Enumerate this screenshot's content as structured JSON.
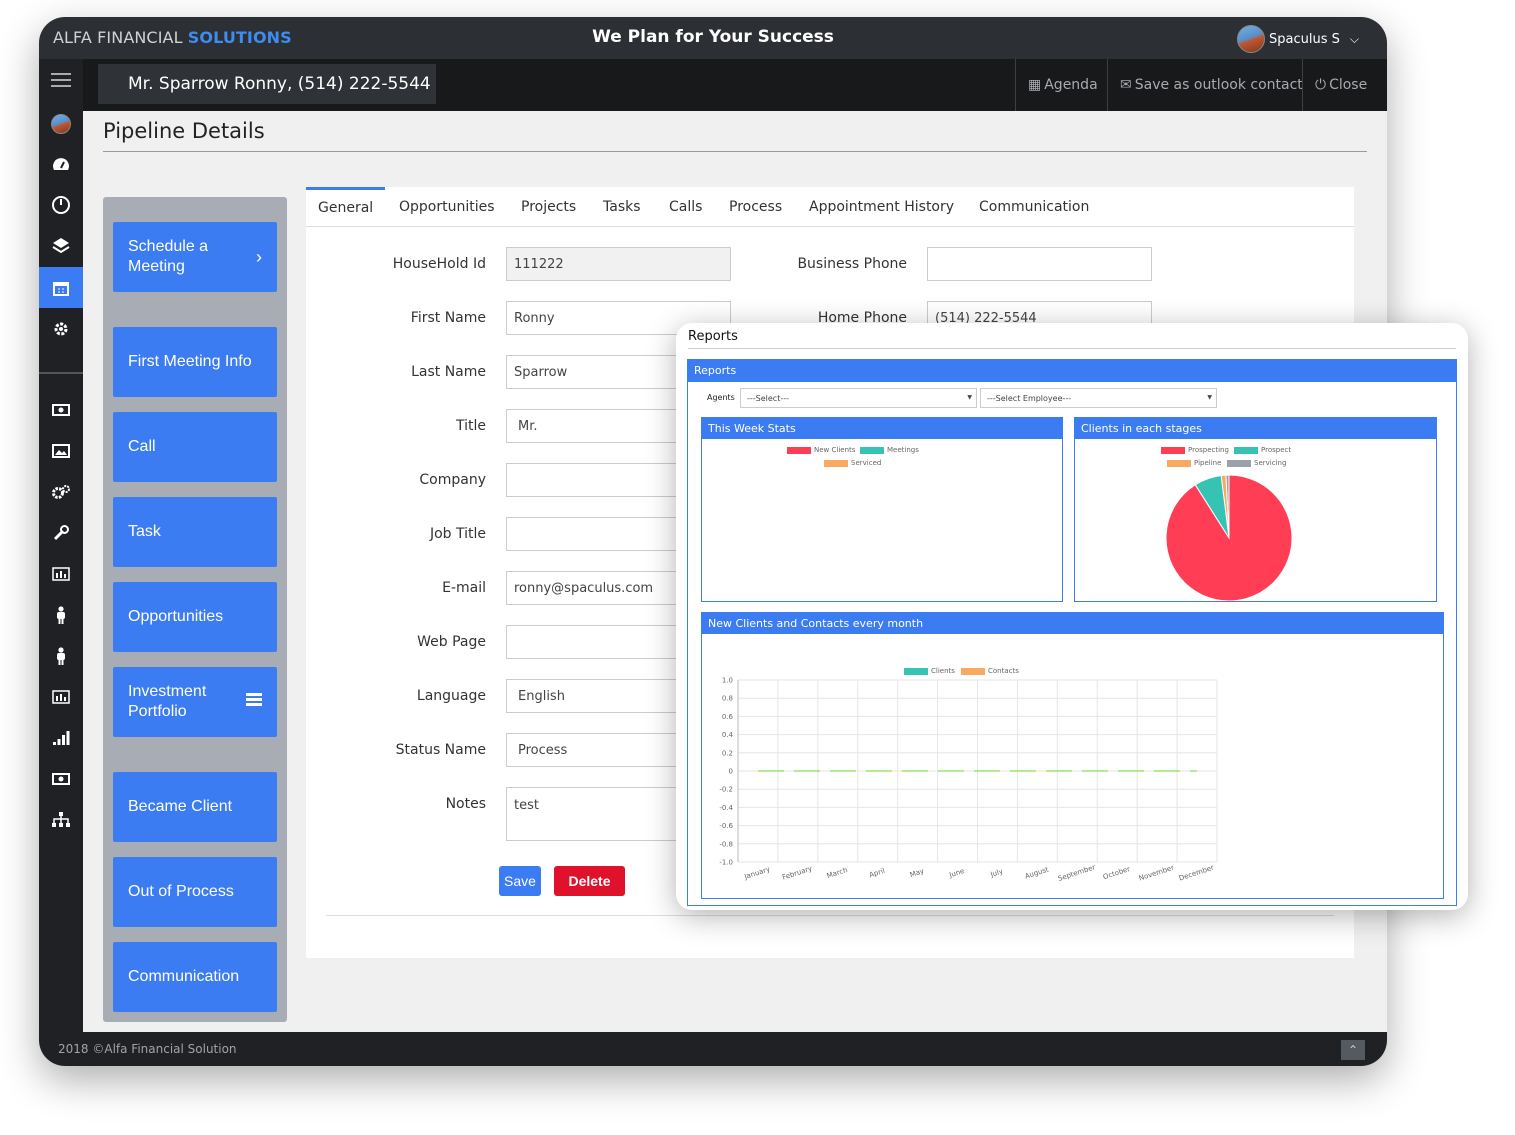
{
  "brand": {
    "part1": "ALFA FINANCIAL ",
    "part2": "SOLUTIONS"
  },
  "tagline": "We Plan for Your Success",
  "user": {
    "name": "Spaculus S",
    "chevron": "⌄"
  },
  "contact": {
    "name": "Mr. Sparrow Ronny, (514) 222-5544"
  },
  "toolbar": {
    "agenda": "Agenda",
    "save_outlook": "Save as outlook contact",
    "close": "Close"
  },
  "sidebar_icons": [
    "menu-icon",
    "avatar",
    "dashboard-icon",
    "dial-icon",
    "layers-icon",
    "calendar-icon",
    "settings-icon",
    "money-icon",
    "image-icon",
    "gears-icon",
    "wrench-icon",
    "bar-chart-icon",
    "person-icon",
    "person-icon",
    "bar-chart-icon",
    "signal-icon",
    "money-icon",
    "sitemap-icon"
  ],
  "page_title": "Pipeline Details",
  "left_buttons": [
    {
      "label": "Schedule a Meeting",
      "icon": "chevron-right-icon"
    },
    {
      "label": "First Meeting Info"
    },
    {
      "label": "Call"
    },
    {
      "label": "Task"
    },
    {
      "label": "Opportunities"
    },
    {
      "label": "Investment Portfolio",
      "icon": "list-icon"
    },
    {
      "label": "Became Client"
    },
    {
      "label": "Out of Process"
    },
    {
      "label": "Communication"
    }
  ],
  "tabs": [
    "General",
    "Opportunities",
    "Projects",
    "Tasks",
    "Calls",
    "Process",
    "Appointment History",
    "Communication"
  ],
  "active_tab": "General",
  "form": {
    "household_id": {
      "label": "HouseHold Id",
      "value": "111222"
    },
    "first_name": {
      "label": "First Name",
      "value": "Ronny"
    },
    "last_name": {
      "label": "Last Name",
      "value": "Sparrow"
    },
    "title": {
      "label": "Title",
      "value": "Mr."
    },
    "company": {
      "label": "Company",
      "value": ""
    },
    "job_title": {
      "label": "Job Title",
      "value": ""
    },
    "email": {
      "label": "E-mail",
      "value": "ronny@spaculus.com"
    },
    "web_page": {
      "label": "Web Page",
      "value": ""
    },
    "language": {
      "label": "Language",
      "value": "English"
    },
    "status_name": {
      "label": "Status Name",
      "value": "Process"
    },
    "notes": {
      "label": "Notes",
      "value": "test"
    },
    "business_phone": {
      "label": "Business Phone",
      "value": ""
    },
    "home_phone": {
      "label": "Home Phone",
      "value": "(514) 222-5544"
    }
  },
  "actions": {
    "save": "Save",
    "delete": "Delete"
  },
  "footer": {
    "copyright": "2018 ©Alfa Financial Solution"
  },
  "reports": {
    "window_title": "Reports",
    "panel_title": "Reports",
    "agents_label": "Agents",
    "agent_select": "---Select---",
    "employee_select": "---Select Employee---"
  },
  "colors": {
    "accent": "#3c7cf2",
    "danger": "#e0112b",
    "topbar": "#2c2f33",
    "sidebar": "#1f2124"
  },
  "chart_data": [
    {
      "type": "bar",
      "title": "This Week Stats",
      "series": [
        {
          "name": "New Clients",
          "color": "#ff3d55",
          "values": []
        },
        {
          "name": "Meetings",
          "color": "#36c3b4",
          "values": []
        },
        {
          "name": "Serviced",
          "color": "#f9a860",
          "values": []
        }
      ]
    },
    {
      "type": "pie",
      "title": "Clients in each stages",
      "slices": [
        {
          "name": "Prospecting",
          "value": 91,
          "color": "#ff3d55"
        },
        {
          "name": "Prospect",
          "value": 7,
          "color": "#36c3b4"
        },
        {
          "name": "Pipeline",
          "value": 1.2,
          "color": "#f9a860"
        },
        {
          "name": "Servicing",
          "value": 0.8,
          "color": "#9aa1a9"
        }
      ]
    },
    {
      "type": "line",
      "title": "New Clients and Contacts every month",
      "categories": [
        "January",
        "February",
        "March",
        "April",
        "May",
        "June",
        "July",
        "August",
        "September",
        "October",
        "November",
        "December"
      ],
      "ylim": [
        -1.0,
        1.0
      ],
      "yticks": [
        "1.0",
        "0.8",
        "0.6",
        "0.4",
        "0.2",
        "0",
        "-0.2",
        "-0.4",
        "-0.6",
        "-0.8",
        "-1.0"
      ],
      "series": [
        {
          "name": "Clients",
          "color": "#36c3b4",
          "values": [
            0,
            0,
            0,
            0,
            0,
            0,
            0,
            0,
            0,
            0,
            0,
            0
          ]
        },
        {
          "name": "Contacts",
          "color": "#f9a860",
          "values": [
            0,
            0,
            0,
            0,
            0,
            0,
            0,
            0,
            0,
            0,
            0,
            0
          ]
        }
      ],
      "grid": true,
      "legend": "top"
    }
  ]
}
